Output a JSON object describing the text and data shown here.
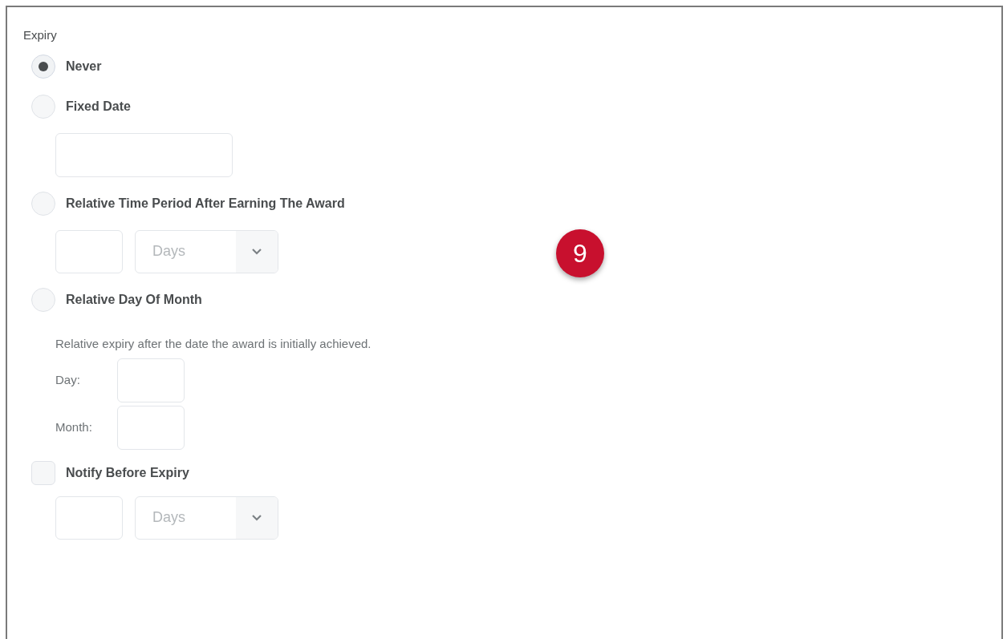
{
  "section_title": "Expiry",
  "rows": [
    {
      "kind": "radio",
      "label": "Never",
      "selected": true
    },
    {
      "kind": "radio",
      "label": "Fixed Date",
      "selected": false
    },
    {
      "kind": "date_field"
    },
    {
      "kind": "radio",
      "label": "Relative Time Period After Earning The Award",
      "selected": false
    },
    {
      "kind": "number_unit",
      "unit": "Days"
    },
    {
      "kind": "radio",
      "label": "Relative Day Of Month",
      "selected": false
    },
    {
      "kind": "help_text",
      "text": "Relative expiry after the date the award is initially achieved."
    },
    {
      "kind": "labeled_field",
      "label": "Day:"
    },
    {
      "kind": "labeled_field",
      "label": "Month:"
    },
    {
      "kind": "checkbox",
      "label": "Notify Before Expiry",
      "checked": false
    },
    {
      "kind": "number_unit",
      "unit": "Days"
    }
  ],
  "step_badge": "9"
}
